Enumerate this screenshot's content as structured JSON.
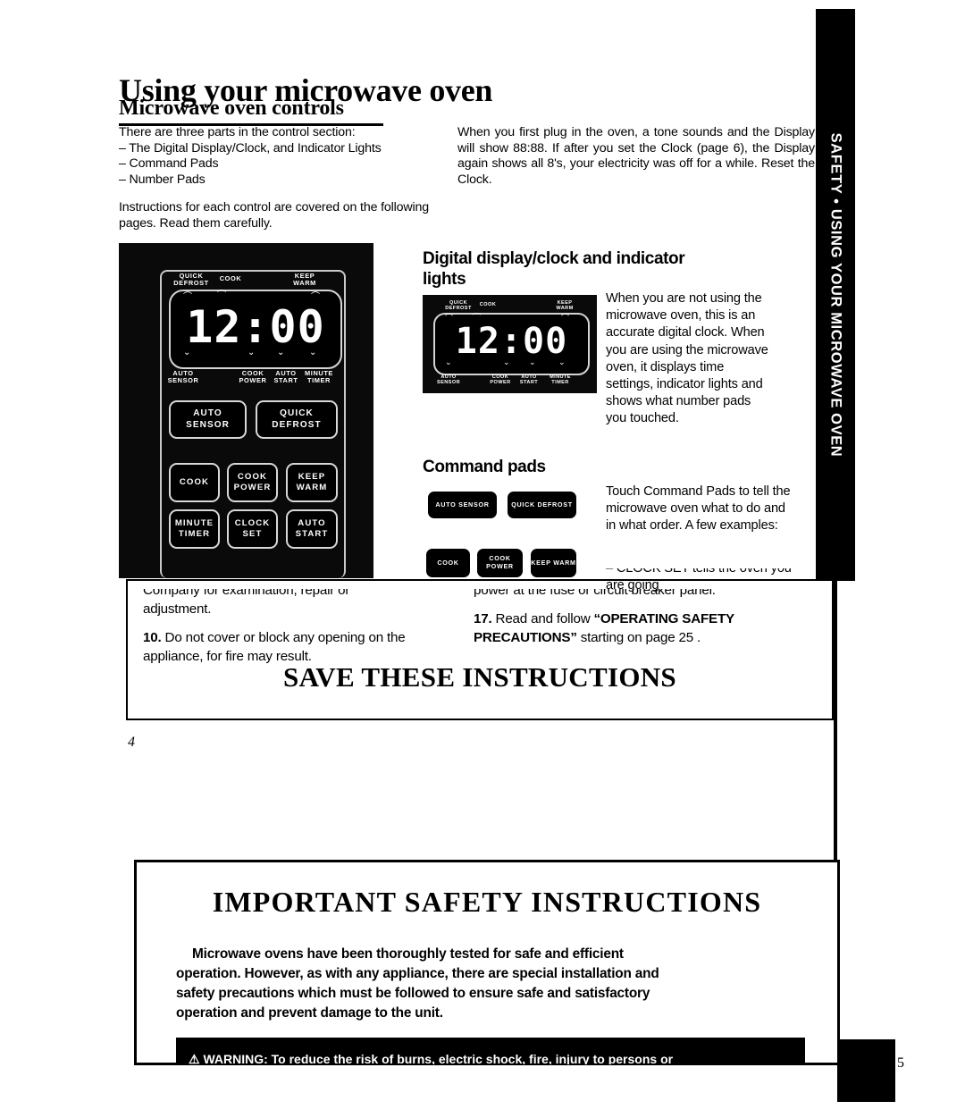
{
  "document": {
    "side_tab": "SAFETY • USING YOUR MICROWAVE OVEN"
  },
  "page4": {
    "number": "4",
    "title": "Using your microwave oven",
    "section_heading": "Microwave oven controls",
    "intro_left": {
      "lead": "There are three parts in the control section:",
      "bullets": [
        "– The Digital Display/Clock, and Indicator Lights",
        "– Command Pads",
        "– Number Pads"
      ],
      "paragraph": "Instructions for each control are covered on the following pages. Read them carefully."
    },
    "intro_right": "When you first plug in the oven, a tone sounds and the Display will show 88:88. If after you set the Clock (page 6), the Display again shows all 8's, your electricity was off for a while. Reset the Clock.",
    "control_panel": {
      "display_value": "12:00",
      "indicators_top": [
        "QUICK DEFROST",
        "COOK",
        "KEEP WARM"
      ],
      "indicators_bottom": [
        "AUTO SENSOR",
        "COOK POWER",
        "AUTO START",
        "MINUTE TIMER"
      ],
      "pads_row1": [
        "AUTO SENSOR",
        "QUICK DEFROST"
      ],
      "pads_row2": [
        "COOK",
        "COOK POWER",
        "KEEP WARM"
      ],
      "pads_row3": [
        "MINUTE TIMER",
        "CLOCK SET",
        "AUTO START"
      ]
    },
    "digital_display_section": {
      "heading": "Digital display/clock and indicator lights",
      "text": "When you are not using the microwave oven, this is an accurate digital clock. When you are using the microwave oven, it displays time settings, indicator lights and shows what number pads you touched."
    },
    "command_pads_section": {
      "heading": "Command pads",
      "text": "Touch Command Pads to tell the microwave oven what to do and in what order. A few examples:",
      "example": "– CLOCK SET tells the oven you are going",
      "pads_row1": [
        "AUTO SENSOR",
        "QUICK DEFROST"
      ],
      "pads_row2": [
        "COOK",
        "COOK POWER",
        "KEEP WARM"
      ]
    },
    "bleed_through": {
      "left_line1": "Company for examination, repair or",
      "left_line2": "adjustment.",
      "item10_num": "10.",
      "item10_text": "Do not cover or block any opening on the appliance, for fire may result.",
      "right_line1": "power at the fuse or circuit breaker panel.",
      "item17_num": "17.",
      "item17_text_a": "Read and follow",
      "item17_bold": "“OPERATING SAFETY PRECAUTIONS”",
      "item17_text_b": "starting on page 25 ."
    },
    "save_banner": "SAVE THESE INSTRUCTIONS"
  },
  "page5": {
    "number": "5",
    "title": "IMPORTANT SAFETY INSTRUCTIONS",
    "body_line1": "Microwave ovens have been thoroughly tested for safe and efficient",
    "body_line2": "operation. However, as with any appliance, there are special installation and",
    "body_line3": "safety precautions which must be followed to ensure safe and satisfactory",
    "body_line4": "operation and prevent damage to the unit.",
    "warning": "⚠  WARNING: To reduce the risk of burns, electric shock, fire, injury to persons or"
  }
}
